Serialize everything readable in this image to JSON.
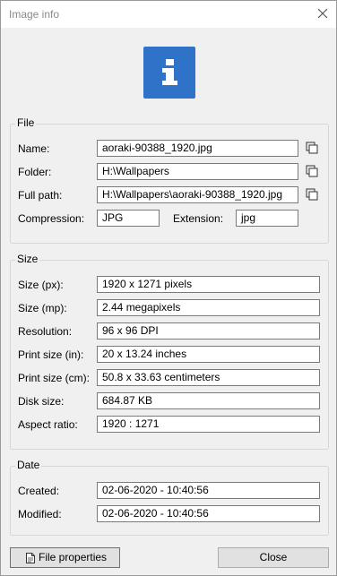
{
  "window": {
    "title": "Image info"
  },
  "file": {
    "label": "File",
    "name_label": "Name:",
    "name_value": "aoraki-90388_1920.jpg",
    "folder_label": "Folder:",
    "folder_value": "H:\\Wallpapers",
    "fullpath_label": "Full path:",
    "fullpath_value": "H:\\Wallpapers\\aoraki-90388_1920.jpg",
    "compression_label": "Compression:",
    "compression_value": "JPG",
    "extension_label": "Extension:",
    "extension_value": "jpg"
  },
  "size": {
    "label": "Size",
    "px_label": "Size (px):",
    "px_value": "1920 x 1271 pixels",
    "mp_label": "Size (mp):",
    "mp_value": "2.44 megapixels",
    "res_label": "Resolution:",
    "res_value": "96 x 96 DPI",
    "print_in_label": "Print size (in):",
    "print_in_value": "20 x 13.24 inches",
    "print_cm_label": "Print size (cm):",
    "print_cm_value": "50.8 x 33.63 centimeters",
    "disk_label": "Disk size:",
    "disk_value": "684.87 KB",
    "aspect_label": "Aspect ratio:",
    "aspect_value": "1920 : 1271"
  },
  "date": {
    "label": "Date",
    "created_label": "Created:",
    "created_value": "02-06-2020 - 10:40:56",
    "modified_label": "Modified:",
    "modified_value": "02-06-2020 - 10:40:56"
  },
  "buttons": {
    "file_properties": "File properties",
    "close": "Close"
  },
  "icons": {
    "header": "info-icon",
    "copy": "copy-icon",
    "close": "close-icon",
    "document": "document-icon"
  },
  "colors": {
    "accent": "#2f73c8"
  }
}
